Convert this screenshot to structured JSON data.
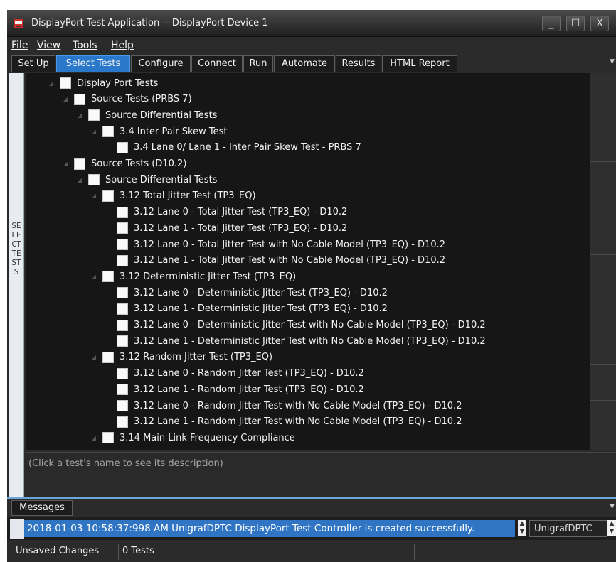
{
  "window": {
    "title": "DisplayPort Test Application -- DisplayPort Device 1",
    "controls": [
      "_",
      "☐",
      "X"
    ]
  },
  "menubar": {
    "items": [
      "File",
      "View",
      "Tools",
      "Help"
    ]
  },
  "tabs": {
    "items": [
      "Set Up",
      "Select Tests",
      "Configure",
      "Connect",
      "Run",
      "Automate",
      "Results",
      "HTML Report"
    ],
    "active": "Select Tests"
  },
  "side_tab": {
    "label": "SELECT TESTS"
  },
  "tree": {
    "rows": [
      {
        "label": "Display Port Tests"
      },
      {
        "label": "Source Tests (PRBS 7)"
      },
      {
        "label": "Source Differential Tests"
      },
      {
        "label": "3.4  Inter Pair Skew Test"
      },
      {
        "label": "3.4  Lane 0/ Lane 1 - Inter Pair Skew Test - PRBS 7"
      },
      {
        "label": "Source Tests (D10.2)"
      },
      {
        "label": "Source Differential Tests"
      },
      {
        "label": "3.12  Total Jitter Test (TP3_EQ)"
      },
      {
        "label": "3.12  Lane 0 - Total Jitter Test (TP3_EQ) - D10.2"
      },
      {
        "label": "3.12  Lane 1 - Total Jitter Test (TP3_EQ) - D10.2"
      },
      {
        "label": "3.12  Lane 0 - Total Jitter Test with No Cable Model (TP3_EQ) - D10.2"
      },
      {
        "label": "3.12  Lane 1 - Total Jitter Test with No Cable Model (TP3_EQ) - D10.2"
      },
      {
        "label": "3.12  Deterministic Jitter Test (TP3_EQ)"
      },
      {
        "label": "3.12  Lane 0 - Deterministic Jitter Test (TP3_EQ) - D10.2"
      },
      {
        "label": "3.12  Lane 1 - Deterministic Jitter Test (TP3_EQ) - D10.2"
      },
      {
        "label": "3.12  Lane 0 - Deterministic Jitter Test with No Cable Model (TP3_EQ) - D10.2"
      },
      {
        "label": "3.12  Lane 1 - Deterministic Jitter Test with No Cable Model (TP3_EQ) - D10.2"
      },
      {
        "label": "3.12  Random Jitter Test (TP3_EQ)"
      },
      {
        "label": "3.12  Lane 0 - Random Jitter Test (TP3_EQ) - D10.2"
      },
      {
        "label": "3.12  Lane 1 - Random Jitter Test (TP3_EQ) - D10.2"
      },
      {
        "label": "3.12  Lane 0 - Random Jitter Test with No Cable Model (TP3_EQ) - D10.2"
      },
      {
        "label": "3.12  Lane 1 - Random Jitter Test with No Cable Model (TP3_EQ) - D10.2"
      },
      {
        "label": "3.14  Main Link Frequency Compliance"
      }
    ]
  },
  "description": {
    "text": "(Click a test's name to see its description)"
  },
  "messages": {
    "tab_label": "Messages",
    "latest": "2018-01-03 10:58:37:998 AM UnigrafDPTC DisplayPort Test Controller is created successfully.",
    "source": "UnigrafDPTC"
  },
  "status": {
    "unsaved": "Unsaved Changes",
    "tests": "0 Tests"
  },
  "colors": {
    "accent": "#2a78c9",
    "tree_bg": "#161616",
    "window_bg": "#2b2b2b"
  }
}
